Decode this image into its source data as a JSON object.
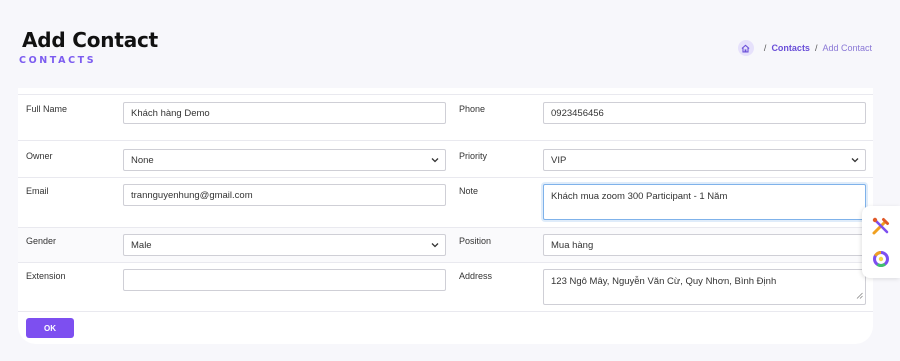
{
  "header": {
    "title": "Add Contact",
    "subtitle": "CONTACTS"
  },
  "breadcrumb": {
    "separator": "/",
    "items": [
      "Contacts",
      "Add Contact"
    ]
  },
  "form": {
    "full_name": {
      "label": "Full Name",
      "value": "Khách hàng Demo"
    },
    "phone": {
      "label": "Phone",
      "value": "0923456456"
    },
    "owner": {
      "label": "Owner",
      "value": "None"
    },
    "priority": {
      "label": "Priority",
      "value": "VIP"
    },
    "email": {
      "label": "Email",
      "value": "trannguyenhung@gmail.com"
    },
    "note": {
      "label": "Note",
      "value": "Khách mua zoom 300 Participant - 1 Năm"
    },
    "gender": {
      "label": "Gender",
      "value": "Male"
    },
    "position": {
      "label": "Position",
      "value": "Mua hàng"
    },
    "extension": {
      "label": "Extension",
      "value": ""
    },
    "address": {
      "label": "Address",
      "value": "123 Ngô Mây, Nguyễn Văn Cừ, Quy Nhơn, Bình Định"
    }
  },
  "ok_button": "OK",
  "colors": {
    "accent": "#7d4ff0",
    "focus_border": "#7fb2ea"
  },
  "side_tools": [
    "tools-icon",
    "refresh-ring-icon"
  ]
}
